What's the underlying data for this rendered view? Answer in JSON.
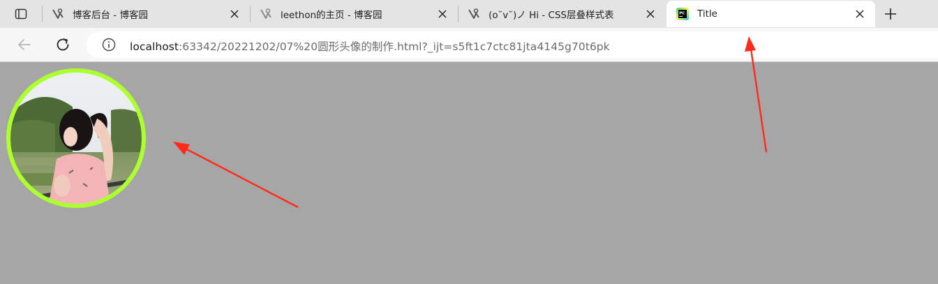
{
  "tabs": [
    {
      "title": "博客后台 - 博客园",
      "favicon": "cnblogs-icon",
      "active": false
    },
    {
      "title": "leethon的主页 - 博客园",
      "favicon": "cnblogs-icon",
      "active": false
    },
    {
      "title": "(o˘v˘)ノ Hi - CSS层叠样式表",
      "favicon": "cnblogs-icon",
      "active": false
    },
    {
      "title": "Title",
      "favicon": "pycharm-icon",
      "active": true
    }
  ],
  "address_bar": {
    "host": "localhost",
    "path": ":63342/20221202/07%20圆形头像的制作.html?_ijt=s5ft1c7ctc81jta4145g70t6pk"
  },
  "avatar": {
    "border_color": "#adff2f",
    "subject": "circular-avatar-photo"
  },
  "annotations": {
    "arrow_color": "#ff2a1a"
  },
  "colors": {
    "page_background": "#a6a6a6",
    "tabstrip_background": "#e4e4e4"
  }
}
